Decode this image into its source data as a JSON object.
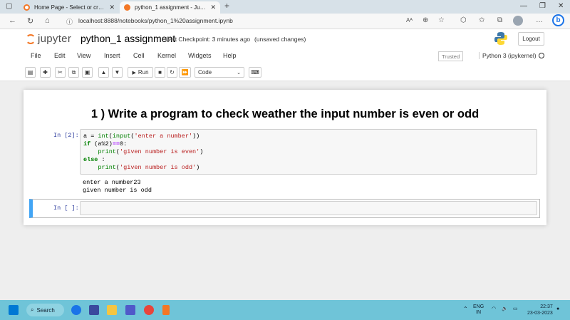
{
  "browser": {
    "tabs": [
      {
        "title": "Home Page - Select or create a n",
        "active": false
      },
      {
        "title": "python_1 assignment - Jupyter N",
        "active": true
      }
    ],
    "new_tab": "+",
    "url": "localhost:8888/notebooks/python_1%20assignment.ipynb"
  },
  "jupyter": {
    "logo_text": "jupyter",
    "notebook_name": "python_1 assignment",
    "checkpoint": "Last Checkpoint: 3 minutes ago",
    "save_status": "(unsaved changes)",
    "logout_label": "Logout",
    "menu": [
      "File",
      "Edit",
      "View",
      "Insert",
      "Cell",
      "Kernel",
      "Widgets",
      "Help"
    ],
    "trusted_label": "Trusted",
    "kernel_name": "Python 3 (ipykernel)",
    "toolbar": {
      "run_label": "Run",
      "cell_type": "Code"
    }
  },
  "notebook": {
    "heading": "1 ) Write a program to check weather the input number is even or odd",
    "cells": [
      {
        "prompt": "In [2]:",
        "code_lines": [
          "a = int(input('enter a number'))",
          "if (a%2)==0:",
          "    print('given number is even')",
          "else :",
          "    print('given number is odd')"
        ],
        "output_lines": [
          "enter a number23",
          "given number is odd"
        ]
      },
      {
        "prompt": "In [ ]:",
        "code_lines": [],
        "output_lines": []
      }
    ]
  },
  "taskbar": {
    "search_label": "Search",
    "lang_top": "ENG",
    "lang_bottom": "IN",
    "time": "22:37",
    "date": "23-03-2023"
  },
  "colors": {
    "jupyter_orange": "#f37726",
    "prompt_blue": "#303f9f",
    "selected_cell_border": "#42a5f5",
    "taskbar": "#6fc4d8"
  }
}
